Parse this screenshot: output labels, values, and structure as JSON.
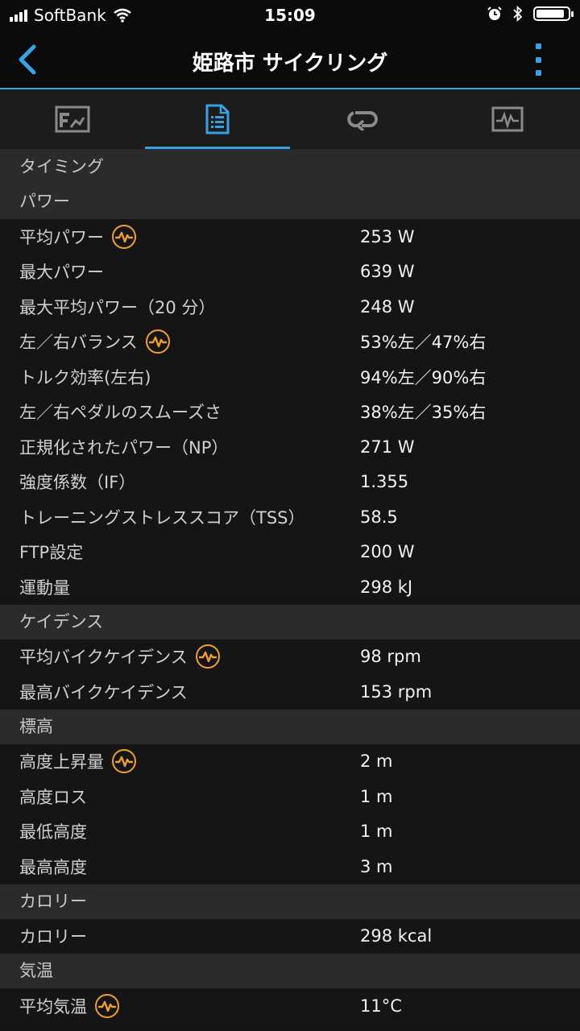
{
  "status": {
    "carrier": "SoftBank",
    "time": "15:09"
  },
  "nav": {
    "title": "姫路市 サイクリング"
  },
  "tabs": [
    {
      "icon": "chart-summary-icon",
      "active": false
    },
    {
      "icon": "document-list-icon",
      "active": true
    },
    {
      "icon": "laps-loop-icon",
      "active": false
    },
    {
      "icon": "graph-pulse-icon",
      "active": false
    }
  ],
  "sections": [
    {
      "title": "タイミング",
      "rows": []
    },
    {
      "title": "パワー",
      "rows": [
        {
          "label": "平均パワー",
          "value": "253 W",
          "badge": true
        },
        {
          "label": "最大パワー",
          "value": "639 W",
          "badge": false
        },
        {
          "label": "最大平均パワー（20 分）",
          "value": "248 W",
          "badge": false
        },
        {
          "label": "左／右バランス",
          "value": "53%左／47%右",
          "badge": true
        },
        {
          "label": "トルク効率(左右)",
          "value": "94%左／90%右",
          "badge": false
        },
        {
          "label": "左／右ペダルのスムーズさ",
          "value": "38%左／35%右",
          "badge": false
        },
        {
          "label": "正規化されたパワー（NP）",
          "value": "271 W",
          "badge": false
        },
        {
          "label": "強度係数（IF）",
          "value": "1.355",
          "badge": false
        },
        {
          "label": "トレーニングストレススコア（TSS）",
          "value": "58.5",
          "badge": false
        },
        {
          "label": "FTP設定",
          "value": "200 W",
          "badge": false
        },
        {
          "label": "運動量",
          "value": "298 kJ",
          "badge": false
        }
      ]
    },
    {
      "title": "ケイデンス",
      "rows": [
        {
          "label": "平均バイクケイデンス",
          "value": "98 rpm",
          "badge": true
        },
        {
          "label": "最高バイクケイデンス",
          "value": "153 rpm",
          "badge": false
        }
      ]
    },
    {
      "title": "標高",
      "rows": [
        {
          "label": "高度上昇量",
          "value": "2 m",
          "badge": true
        },
        {
          "label": "高度ロス",
          "value": "1 m",
          "badge": false
        },
        {
          "label": "最低高度",
          "value": "1 m",
          "badge": false
        },
        {
          "label": "最高高度",
          "value": "3 m",
          "badge": false
        }
      ]
    },
    {
      "title": "カロリー",
      "rows": [
        {
          "label": "カロリー",
          "value": "298 kcal",
          "badge": false
        }
      ]
    },
    {
      "title": "気温",
      "rows": [
        {
          "label": "平均気温",
          "value": "11°C",
          "badge": true
        }
      ]
    }
  ],
  "colors": {
    "accent": "#3aa0e6",
    "badge": "#f0a030"
  },
  "battery_level": 0.9
}
